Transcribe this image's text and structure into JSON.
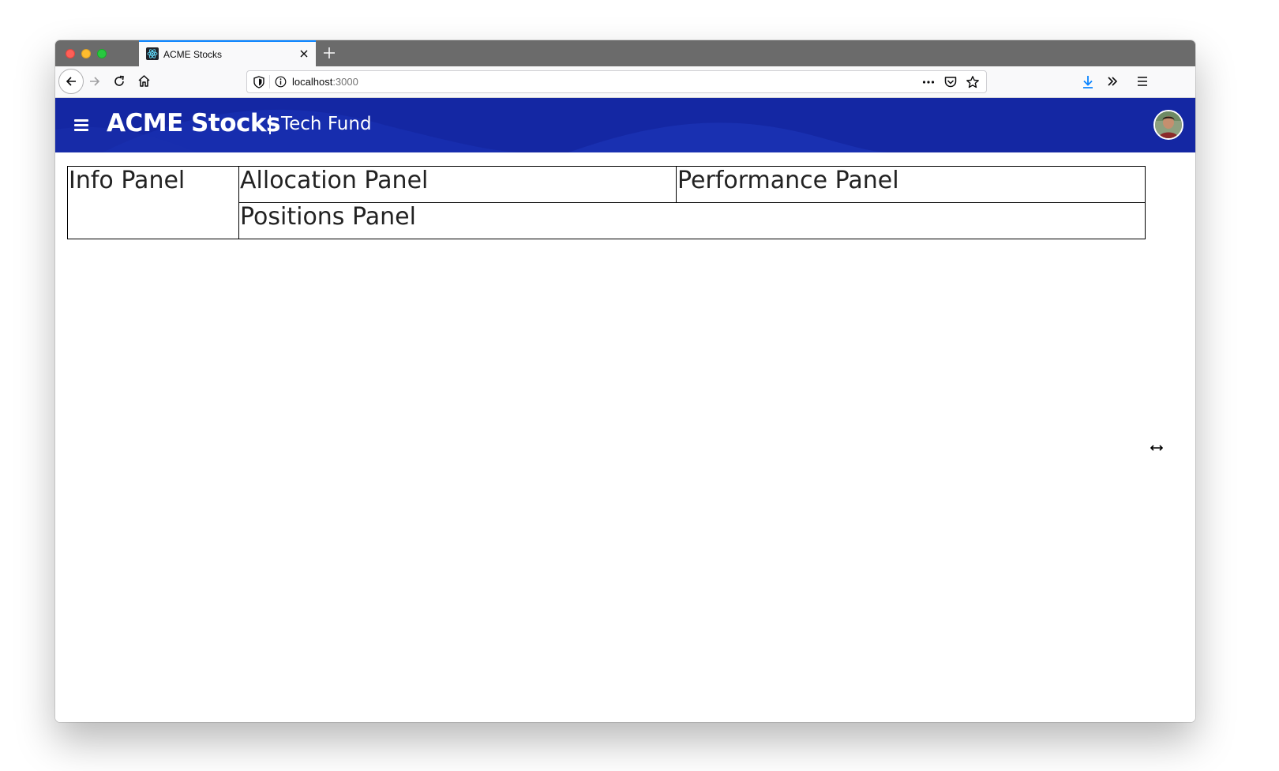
{
  "browser": {
    "tab": {
      "title": "ACME Stocks",
      "favicon": "react-atom-icon"
    },
    "url": {
      "host": "localhost",
      "port": ":3000"
    },
    "icons": {
      "back": "back-arrow-icon",
      "forward": "forward-arrow-icon",
      "reload": "reload-icon",
      "home": "home-icon",
      "shield": "shield-icon",
      "info": "info-icon",
      "more": "more-icon",
      "pocket": "pocket-icon",
      "star": "star-icon",
      "download": "download-icon",
      "overflow": "overflow-icon",
      "menu": "menu-icon"
    },
    "colors": {
      "accent": "#0a84ff",
      "tabstrip": "#6b6b6b"
    }
  },
  "app": {
    "title": "ACME Stocks",
    "fund": "Tech Fund",
    "header_color": "#1427a3"
  },
  "panels": {
    "info": "Info Panel",
    "allocation": "Allocation Panel",
    "performance": "Performance Panel",
    "positions": "Positions Panel"
  }
}
